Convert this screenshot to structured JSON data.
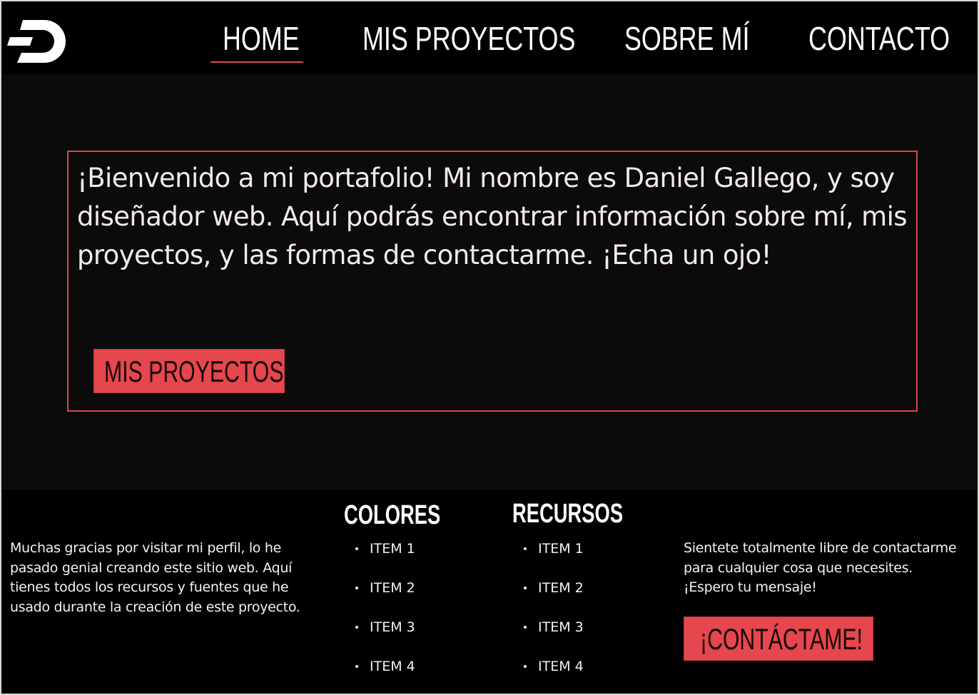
{
  "header": {
    "logo_icon": "dash-d-logo-icon",
    "nav": [
      {
        "label": "HOME",
        "active": true
      },
      {
        "label": "MIS PROYECTOS",
        "active": false
      },
      {
        "label": "SOBRE MÍ",
        "active": false
      },
      {
        "label": "CONTACTO",
        "active": false
      }
    ]
  },
  "hero": {
    "text": "¡Bienvenido a mi portafolio! Mi nombre es Daniel Gallego, y soy diseñador web. Aquí podrás encontrar información sobre mí, mis proyectos, y las formas de contactarme. ¡Echa un ojo!",
    "button_label": "MIS PROYECTOS"
  },
  "footer": {
    "about_text": "Muchas gracias por visitar mi perfil, lo he pasado genial creando este sitio web. Aquí tienes todos los recursos y fuentes que he usado durante la creación de este proyecto.",
    "columns": [
      {
        "heading": "COLORES",
        "items": [
          "ITEM 1",
          "ITEM 2",
          "ITEM 3",
          "ITEM 4"
        ]
      },
      {
        "heading": "RECURSOS",
        "items": [
          "ITEM 1",
          "ITEM 2",
          "ITEM 3",
          "ITEM 4"
        ]
      }
    ],
    "contact_text": "Sientete totalmente libre de contactarme para cualquier cosa que necesites. ¡Espero tu mensaje!",
    "contact_button_label": "¡CONTÁCTAME!"
  },
  "colors": {
    "accent": "#e4474d",
    "background": "#0b0b0b",
    "header_bg": "#000000",
    "text": "#ffffff"
  }
}
